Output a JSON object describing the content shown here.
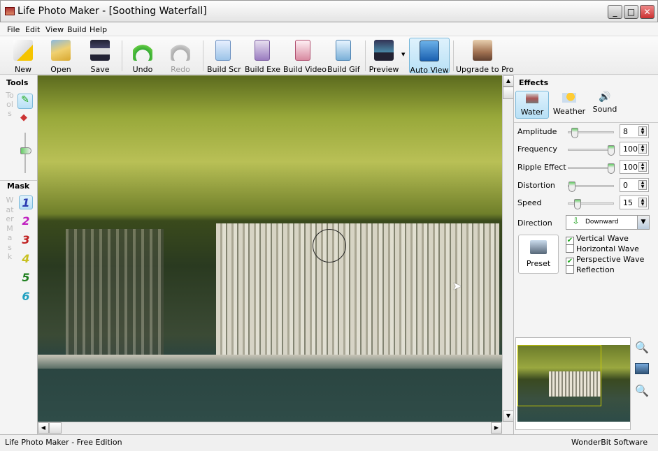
{
  "window": {
    "title": "Life Photo Maker - [Soothing Waterfall]"
  },
  "menu": [
    "File",
    "Edit",
    "View",
    "Build",
    "Help"
  ],
  "toolbar": [
    {
      "label": "New",
      "icon": "new-document-star-icon"
    },
    {
      "label": "Open",
      "icon": "open-folder-icon"
    },
    {
      "label": "Save",
      "icon": "floppy-disk-icon"
    },
    {
      "label": "Undo",
      "icon": "undo-arrow-icon"
    },
    {
      "label": "Redo",
      "icon": "redo-arrow-icon",
      "disabled": true
    },
    {
      "label": "Build Scr",
      "icon": "scr-file-icon"
    },
    {
      "label": "Build Exe",
      "icon": "exe-file-icon"
    },
    {
      "label": "Build Video",
      "icon": "avi-file-icon"
    },
    {
      "label": "Build Gif",
      "icon": "gif-file-icon"
    },
    {
      "label": "Preview",
      "icon": "monitor-icon"
    },
    {
      "label": "Auto View",
      "icon": "play-window-icon",
      "active": true
    },
    {
      "label": "Upgrade to Pro",
      "icon": "photo-icon"
    }
  ],
  "tools": {
    "title": "Tools",
    "vertical_label": "Tools"
  },
  "mask": {
    "title": "Mask",
    "vertical_label": "Water Mask",
    "items": [
      "1",
      "2",
      "3",
      "4",
      "5",
      "6"
    ],
    "colors": [
      "#2a3ab0",
      "#c020c0",
      "#c02020",
      "#c8c020",
      "#208020",
      "#20a0c0"
    ]
  },
  "effects": {
    "title": "Effects",
    "tabs": [
      {
        "label": "Water",
        "active": true
      },
      {
        "label": "Weather"
      },
      {
        "label": "Sound"
      }
    ],
    "sliders": [
      {
        "label": "Amplitude",
        "value": "8",
        "level": 0.08
      },
      {
        "label": "Frequency",
        "value": "100",
        "level": 1.0
      },
      {
        "label": "Ripple Effect",
        "value": "100",
        "level": 1.0
      },
      {
        "label": "Distortion",
        "value": "0",
        "level": 0
      },
      {
        "label": "Speed",
        "value": "15",
        "level": 0.15
      }
    ],
    "direction": {
      "label": "Direction",
      "value": "Downward"
    },
    "preset_label": "Preset",
    "checkboxes": [
      {
        "label": "Vertical Wave",
        "checked": true
      },
      {
        "label": "Horizontal Wave",
        "checked": false
      },
      {
        "label": "Perspective Wave",
        "checked": true
      },
      {
        "label": "Reflection",
        "checked": false
      }
    ]
  },
  "status": {
    "left": "Life Photo Maker - Free Edition",
    "right": "WonderBit Software"
  }
}
